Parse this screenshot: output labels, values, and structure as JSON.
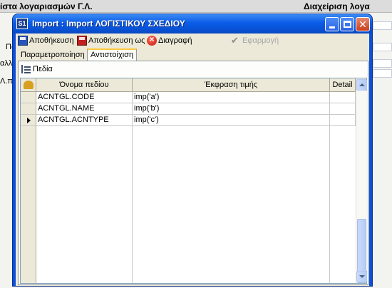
{
  "background": {
    "header_left": "ίστα λογαριασμών Γ.Λ.",
    "header_right": "Διαχείριση λογα",
    "side_labels": [
      "Πα",
      "αλλ",
      "Λ.πα"
    ]
  },
  "window": {
    "icon_text": "S1",
    "title": "Import : Import ΛΟΓΙΣΤΙΚΟΥ ΣΧΕΔΙΟΥ",
    "close_glyph": "✕"
  },
  "toolbar": {
    "save_label": "Αποθήκευση",
    "save_as_label": "Αποθήκευση ως",
    "delete_label": "Διαγραφή",
    "apply_label": "Εφαρμογή",
    "apply_icon_glyph": "✔"
  },
  "tabs": [
    {
      "label": "Παραμετροποίηση",
      "active": false
    },
    {
      "label": "Αντιστοίχιση",
      "active": true
    }
  ],
  "fields_button": {
    "label": "Πεδία"
  },
  "grid": {
    "columns": [
      "Όνομα πεδίου",
      "Έκφραση τιμής",
      "Detail"
    ],
    "rows": [
      {
        "field": "ACNTGL.CODE",
        "expression": "imp('a')",
        "detail": "",
        "current": false
      },
      {
        "field": "ACNTGL.NAME",
        "expression": "imp('b')",
        "detail": "",
        "current": false
      },
      {
        "field": "ACNTGL.ACNTYPE",
        "expression": "imp('c')",
        "detail": "",
        "current": true
      }
    ]
  },
  "colors": {
    "title_bar": "#0a5ce6",
    "client_bg": "#ece9d8",
    "active_tab_highlight": "#ffc83c"
  }
}
